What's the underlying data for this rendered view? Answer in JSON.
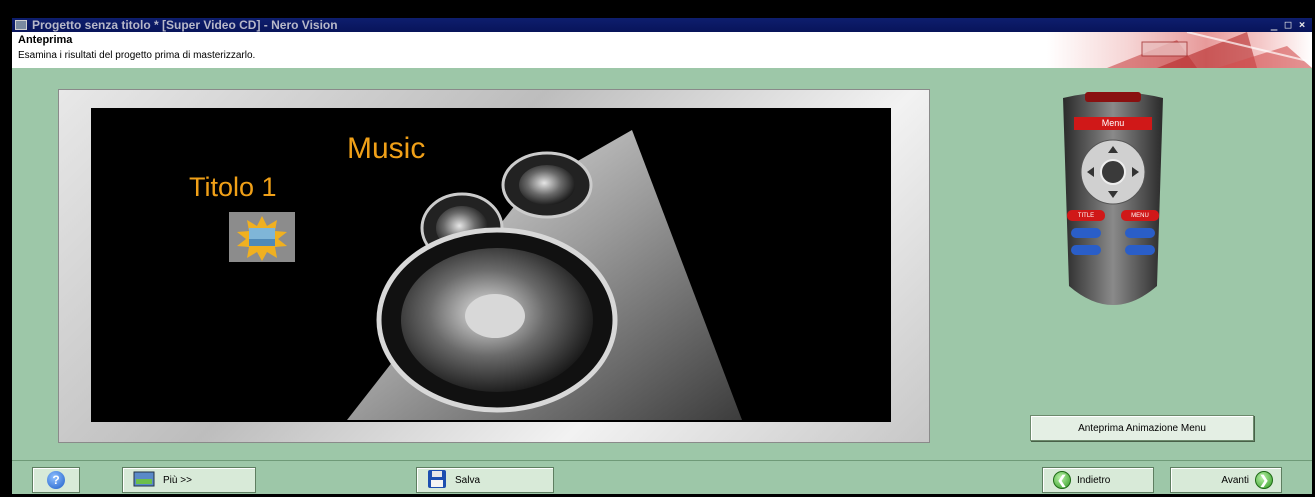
{
  "window": {
    "title": "Progetto senza titolo * [Super Video CD] - Nero Vision",
    "controls": [
      "_",
      "□",
      "×"
    ]
  },
  "header": {
    "title": "Anteprima",
    "subtitle": "Esamina i risultati del progetto prima di masterizzarlo."
  },
  "preview": {
    "menu_title": "Music",
    "title_item": "Titolo 1"
  },
  "remote": {
    "menu_label": "Menu",
    "title_button": "TITLE",
    "menu_button": "MENU"
  },
  "actions": {
    "preview_animation": "Anteprima Animazione Menu"
  },
  "footer": {
    "more": "Più >>",
    "save": "Salva",
    "back": "Indietro",
    "next": "Avanti"
  },
  "icons": {
    "help": "help-icon",
    "more": "more-icon",
    "save": "floppy-icon",
    "back": "arrow-left-icon",
    "next": "arrow-right-icon"
  },
  "colors": {
    "background": "#9dc7a8",
    "title_bar": "#0e1e6e",
    "menu_text": "#f0a018",
    "remote_red": "#d01818"
  }
}
